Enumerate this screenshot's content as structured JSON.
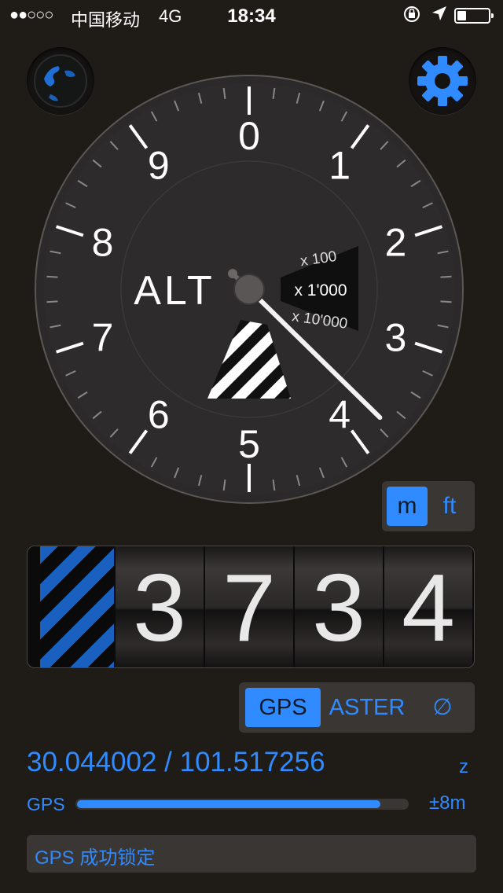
{
  "statusbar": {
    "signal": "●●○○○",
    "carrier": "中国移动",
    "network": "4G",
    "time": "18:34",
    "lock_icon": "rotation-lock-icon",
    "location_icon": "location-arrow-icon",
    "battery_level": 0.3
  },
  "buttons": {
    "globe_icon": "globe-icon",
    "gear_icon": "gear-icon"
  },
  "dial": {
    "label": "ALT",
    "numbers": [
      "0",
      "1",
      "2",
      "3",
      "4",
      "5",
      "6",
      "7",
      "8",
      "9"
    ],
    "multipliers": [
      "x 100",
      "x 1'000",
      "x 10'000"
    ],
    "needle_value": 3.734
  },
  "units": {
    "metric": "m",
    "imperial": "ft",
    "selected": "m"
  },
  "altitude": {
    "digits": [
      "3",
      "7",
      "3",
      "4"
    ]
  },
  "source": {
    "options": [
      "GPS",
      "ASTER",
      "∅"
    ],
    "selected": "GPS"
  },
  "position": {
    "coords": "30.044002 / 101.517256",
    "z_label": "z"
  },
  "accuracy": {
    "label": "GPS",
    "value": "±8m",
    "level": 0.92
  },
  "status": {
    "message": "GPS 成功锁定"
  },
  "colors": {
    "accent": "#2f8bff",
    "background": "#1f1b17",
    "panel": "#3a3633"
  }
}
